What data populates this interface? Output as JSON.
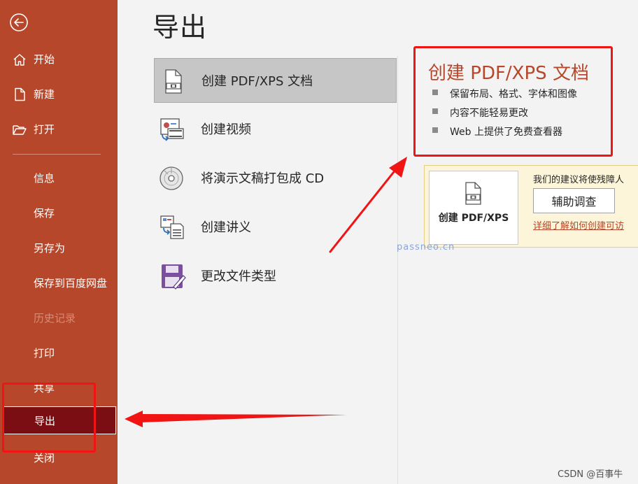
{
  "sidebar": {
    "back_icon": "back-arrow-icon",
    "items_top": [
      {
        "label": "开始",
        "icon": "home-icon"
      },
      {
        "label": "新建",
        "icon": "new-doc-icon"
      },
      {
        "label": "打开",
        "icon": "folder-open-icon"
      }
    ],
    "items_bottom": [
      {
        "label": "信息",
        "state": "normal"
      },
      {
        "label": "保存",
        "state": "normal"
      },
      {
        "label": "另存为",
        "state": "normal"
      },
      {
        "label": "保存到百度网盘",
        "state": "normal"
      },
      {
        "label": "历史记录",
        "state": "disabled"
      },
      {
        "label": "打印",
        "state": "normal"
      },
      {
        "label": "共享",
        "state": "normal"
      },
      {
        "label": "导出",
        "state": "selected"
      },
      {
        "label": "关闭",
        "state": "normal"
      }
    ]
  },
  "main": {
    "title": "导出",
    "options": [
      {
        "label": "创建 PDF/XPS 文档",
        "icon": "pdf-document-icon",
        "selected": true
      },
      {
        "label": "创建视频",
        "icon": "video-icon",
        "selected": false
      },
      {
        "label": "将演示文稿打包成 CD",
        "icon": "cd-disc-icon",
        "selected": false
      },
      {
        "label": "创建讲义",
        "icon": "handout-icon",
        "selected": false
      },
      {
        "label": "更改文件类型",
        "icon": "save-filetype-icon",
        "selected": false
      }
    ]
  },
  "detail": {
    "title": "创建 PDF/XPS 文档",
    "bullets": [
      "保留布局、格式、字体和图像",
      "内容不能轻易更改",
      "Web 上提供了免费查看器"
    ],
    "accessibility": {
      "text": "我们的建议将使残障人",
      "survey_button": "辅助调查",
      "learn_link": "详细了解如何创建可访",
      "create_button": "创建 PDF/XPS"
    }
  },
  "watermark": "passneo.cn",
  "csdn_mark": "CSDN @百事牛",
  "colors": {
    "sidebar_bg": "#b7472a",
    "sidebar_selected": "#7b0e12",
    "accent_red": "#f01414",
    "title_color": "#b7472a"
  }
}
